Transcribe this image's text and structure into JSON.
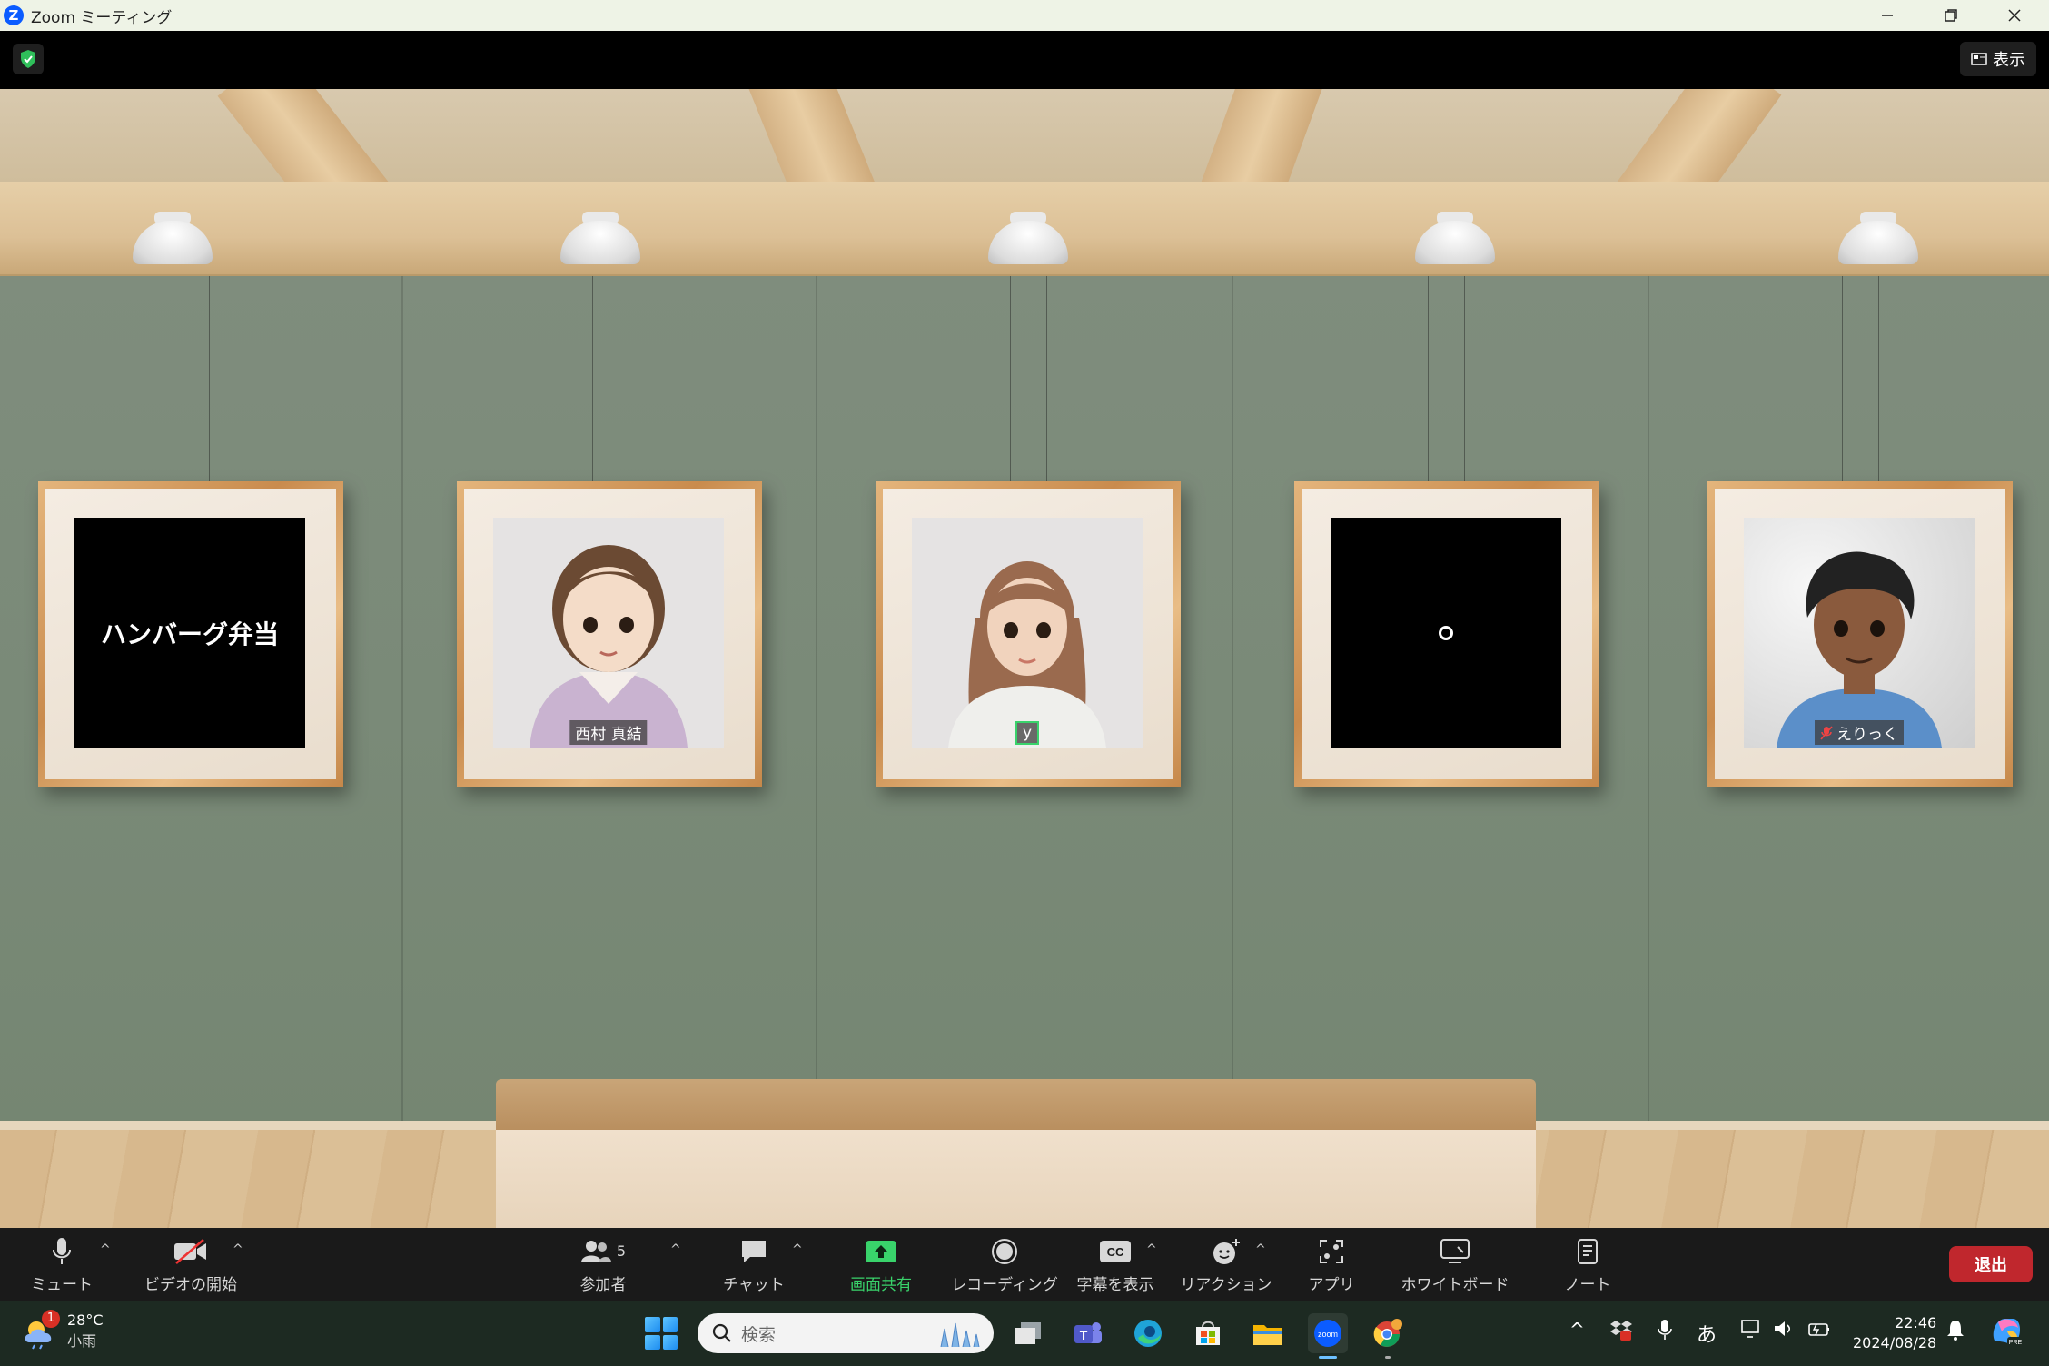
{
  "window": {
    "title": "Zoom ミーティング",
    "controls": [
      "minimize",
      "restore",
      "close"
    ]
  },
  "header": {
    "view_label": "表示"
  },
  "participants": [
    {
      "name": "ハンバーグ弁当",
      "video": "off",
      "display": "name-card"
    },
    {
      "name": "西村 真結",
      "video": "avatar",
      "muted": false
    },
    {
      "name": "y",
      "video": "avatar",
      "active_speaker": true
    },
    {
      "name": "",
      "video": "off",
      "display": "ring"
    },
    {
      "name": "えりっく",
      "video": "avatar",
      "muted": true
    }
  ],
  "toolbar": {
    "mute_label": "ミュート",
    "video_label": "ビデオの開始",
    "participants_label": "参加者",
    "participants_count": "5",
    "chat_label": "チャット",
    "share_label": "画面共有",
    "record_label": "レコーディング",
    "captions_label": "字幕を表示",
    "reactions_label": "リアクション",
    "apps_label": "アプリ",
    "whiteboard_label": "ホワイトボード",
    "notes_label": "ノート",
    "leave_label": "退出"
  },
  "taskbar": {
    "weather_temp": "28°C",
    "weather_cond": "小雨",
    "weather_badge": "1",
    "search_placeholder": "検索",
    "ime": "あ",
    "time": "22:46",
    "date": "2024/08/28"
  },
  "colors": {
    "zoom_blue": "#0b5cff",
    "share_green": "#39d36b",
    "leave_red": "#c0272d",
    "wall": "#7a8a78"
  }
}
